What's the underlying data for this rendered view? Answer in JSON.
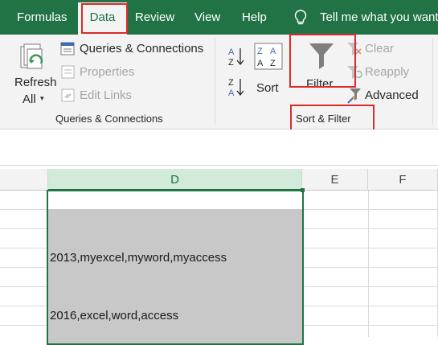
{
  "tabs": {
    "formulas": "Formulas",
    "data": "Data",
    "review": "Review",
    "view": "View",
    "help": "Help",
    "tell_me": "Tell me what you want"
  },
  "queries": {
    "refresh_label": "Refresh",
    "refresh_all": "All",
    "queries_connections": "Queries & Connections",
    "properties": "Properties",
    "edit_links": "Edit Links",
    "group_label": "Queries & Connections"
  },
  "sort_filter": {
    "sort": "Sort",
    "filter": "Filter",
    "clear": "Clear",
    "reapply": "Reapply",
    "advanced": "Advanced",
    "group_label": "Sort & Filter"
  },
  "columns": [
    "D",
    "E",
    "F"
  ],
  "cells": {
    "row4": "2013,myexcel,myword,myaccess",
    "row7": "2016,excel,word,access"
  },
  "colors": {
    "ribbon_green": "#217346",
    "highlight_red": "#d92b2b",
    "cell_fill": "#c8c8c8"
  }
}
